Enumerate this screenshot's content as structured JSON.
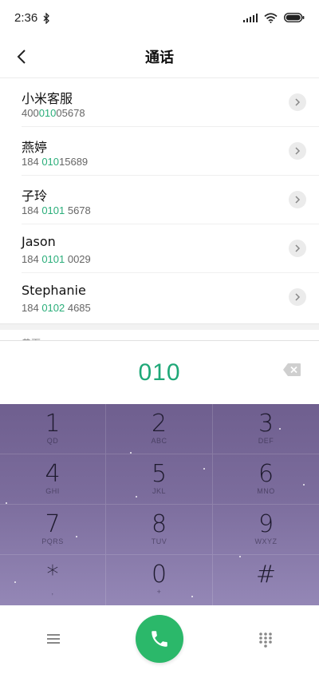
{
  "status_bar": {
    "time": "2:36"
  },
  "header": {
    "title": "通话"
  },
  "contacts": [
    {
      "name": "小米客服",
      "number_prefix": "400",
      "number_match": "010",
      "number_suffix": "05678"
    },
    {
      "name": "燕婷",
      "number_prefix": "184 ",
      "number_match": "010",
      "number_suffix": "15689"
    },
    {
      "name": "子玲",
      "number_prefix": "184 ",
      "number_match": "0101",
      "number_suffix": " 5678"
    },
    {
      "name": "Jason",
      "number_prefix": "184 ",
      "number_match": "0101",
      "number_suffix": " 0029"
    },
    {
      "name": "Stephanie",
      "number_prefix": "184 ",
      "number_match": "0102",
      "number_suffix": " 4685"
    }
  ],
  "section_label": "黄页",
  "dial": {
    "number": "010"
  },
  "keypad": [
    {
      "digit": "1",
      "letters": "QD"
    },
    {
      "digit": "2",
      "letters": "ABC"
    },
    {
      "digit": "3",
      "letters": "DEF"
    },
    {
      "digit": "4",
      "letters": "GHI"
    },
    {
      "digit": "5",
      "letters": "JKL"
    },
    {
      "digit": "6",
      "letters": "MNO"
    },
    {
      "digit": "7",
      "letters": "PQRS"
    },
    {
      "digit": "8",
      "letters": "TUV"
    },
    {
      "digit": "9",
      "letters": "WXYZ"
    },
    {
      "digit": "*",
      "letters": ","
    },
    {
      "digit": "0",
      "letters": "+"
    },
    {
      "digit": "#",
      "letters": ""
    }
  ],
  "colors": {
    "accent": "#1fa878",
    "call": "#2bb86a",
    "keypad_top": "#6f5f8f",
    "keypad_bottom": "#9487b6"
  },
  "icons": {
    "status": [
      "bluetooth-icon",
      "signal-icon",
      "wifi-icon",
      "battery-icon"
    ],
    "header": "back-arrow-icon",
    "row": "chevron-right-icon",
    "input": "backspace-icon",
    "bottom": [
      "menu-icon",
      "phone-icon",
      "dialpad-icon"
    ]
  }
}
